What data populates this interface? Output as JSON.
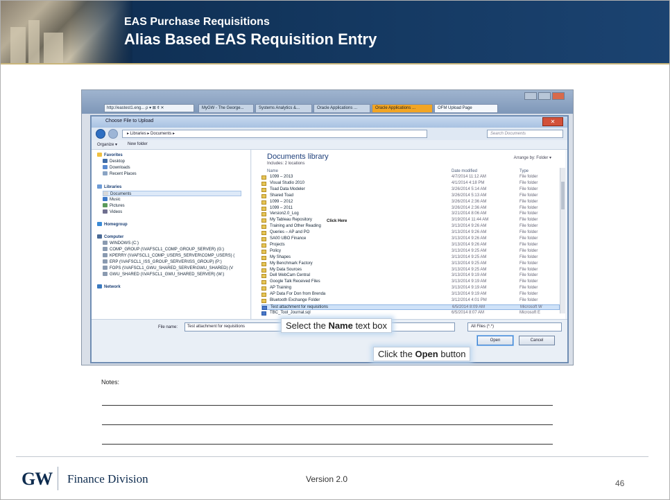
{
  "header": {
    "supertitle": "EAS Purchase Requisitions",
    "title": "Alias Based EAS Requisition Entry"
  },
  "browser": {
    "address": "http://eastest1.eng... ρ ▾ ⊠ ¢ ✕",
    "tabs": [
      "MyGW - The George...",
      "Systems Analytics &...",
      "Oracle Applications ...",
      "Oracle Applications ...",
      "OFM Upload Page"
    ]
  },
  "dialog": {
    "title": "Choose File to Upload",
    "breadcrumb": "▸ Libraries ▸ Documents ▸",
    "search_placeholder": "Search Documents",
    "toolbar": {
      "organize": "Organize ▾",
      "new_folder": "New folder"
    },
    "nav": {
      "favorites": "Favorites",
      "favorites_items": [
        "Desktop",
        "Downloads",
        "Recent Places"
      ],
      "libraries": "Libraries",
      "libraries_items": [
        "Documents",
        "Music",
        "Pictures",
        "Videos"
      ],
      "homegroup": "Homegroup",
      "computer": "Computer",
      "computer_items": [
        "WINDOWS (C:)",
        "COMP_GROUP (\\\\VAFSCL1_COMP_GROUP_SERVER) (G:)",
        "KPERRY (\\\\VAFSCL1_COMP_USERS_SERVER\\COMP_USERS) (",
        "ERP (\\\\VAFSCL1_ISS_GROUP_SERVER\\ISS_GROUP) (P:)",
        "FOPS (\\\\VAFSCL1_GWU_SHARED_SERVER\\GWU_SHARED) (V",
        "GWU_SHARED (\\\\VAFSCL1_GWU_SHARED_SERVER) (W:)"
      ],
      "network": "Network"
    },
    "library": {
      "title": "Documents library",
      "subtitle": "Includes: 2 locations",
      "arrange": "Arrange by:  Folder ▾",
      "columns": {
        "name": "Name",
        "date": "Date modified",
        "type": "Type"
      },
      "rows": [
        {
          "name": "1099 – 2013",
          "date": "4/7/2014 11:12 AM",
          "type": "File folder"
        },
        {
          "name": "Visual Studio 2010",
          "date": "4/1/2014 4:18 PM",
          "type": "File folder"
        },
        {
          "name": "Toad Data Modeler",
          "date": "3/26/2014 5:14 AM",
          "type": "File folder"
        },
        {
          "name": "Shared Toad",
          "date": "3/26/2014 5:13 AM",
          "type": "File folder"
        },
        {
          "name": "1099 – 2012",
          "date": "3/26/2014 2:36 AM",
          "type": "File folder"
        },
        {
          "name": "1099 – 2011",
          "date": "3/26/2014 2:36 AM",
          "type": "File folder"
        },
        {
          "name": "Version2.0_Log",
          "date": "3/21/2014 8:06 AM",
          "type": "File folder"
        },
        {
          "name": "My Tableau Repository",
          "date": "3/19/2014 11:44 AM",
          "type": "File folder"
        },
        {
          "name": "Training and Other Reading",
          "date": "3/13/2014 9:26 AM",
          "type": "File folder"
        },
        {
          "name": "Queries – AP and PO",
          "date": "3/13/2014 9:26 AM",
          "type": "File folder"
        },
        {
          "name": "SA00 UBO Finance",
          "date": "3/13/2014 9:26 AM",
          "type": "File folder"
        },
        {
          "name": "Projects",
          "date": "3/13/2014 9:26 AM",
          "type": "File folder"
        },
        {
          "name": "Policy",
          "date": "3/13/2014 9:25 AM",
          "type": "File folder"
        },
        {
          "name": "My Shapes",
          "date": "3/13/2014 9:25 AM",
          "type": "File folder"
        },
        {
          "name": "My Benchmark Factory",
          "date": "3/13/2014 9:25 AM",
          "type": "File folder"
        },
        {
          "name": "My Data Sources",
          "date": "3/13/2014 9:25 AM",
          "type": "File folder"
        },
        {
          "name": "Dell WebCam Central",
          "date": "3/13/2014 9:19 AM",
          "type": "File folder"
        },
        {
          "name": "Google Talk Received Files",
          "date": "3/13/2014 9:19 AM",
          "type": "File folder"
        },
        {
          "name": "AP Training",
          "date": "3/13/2014 9:19 AM",
          "type": "File folder"
        },
        {
          "name": "AP Data For Don from Brenda",
          "date": "3/13/2014 9:19 AM",
          "type": "File folder"
        },
        {
          "name": "Bluetooth Exchange Folder",
          "date": "3/12/2014 4:01 PM",
          "type": "File folder"
        },
        {
          "name": "Test attachment for requisitions",
          "date": "6/5/2014 8:09 AM",
          "type": "Microsoft W"
        },
        {
          "name": "TBC_Tool_Journal.sql",
          "date": "6/5/2014 8:07 AM",
          "type": "Microsoft E"
        }
      ]
    },
    "file_name_label": "File name:",
    "file_name_value": "Test attachment for requisitions",
    "file_type": "All Files (*.*)",
    "open_label": "Open",
    "cancel_label": "Cancel",
    "click_here_overlay": "Click Here"
  },
  "callouts": {
    "name_pre": "Select the ",
    "name_bold": "Name",
    "name_post": " text box",
    "open_pre": "Click the ",
    "open_bold": "Open",
    "open_post": " button"
  },
  "notes_label": "Notes:",
  "footer": {
    "logo": "GW",
    "division": "Finance Division",
    "version": "Version 2.0",
    "page": "46"
  }
}
